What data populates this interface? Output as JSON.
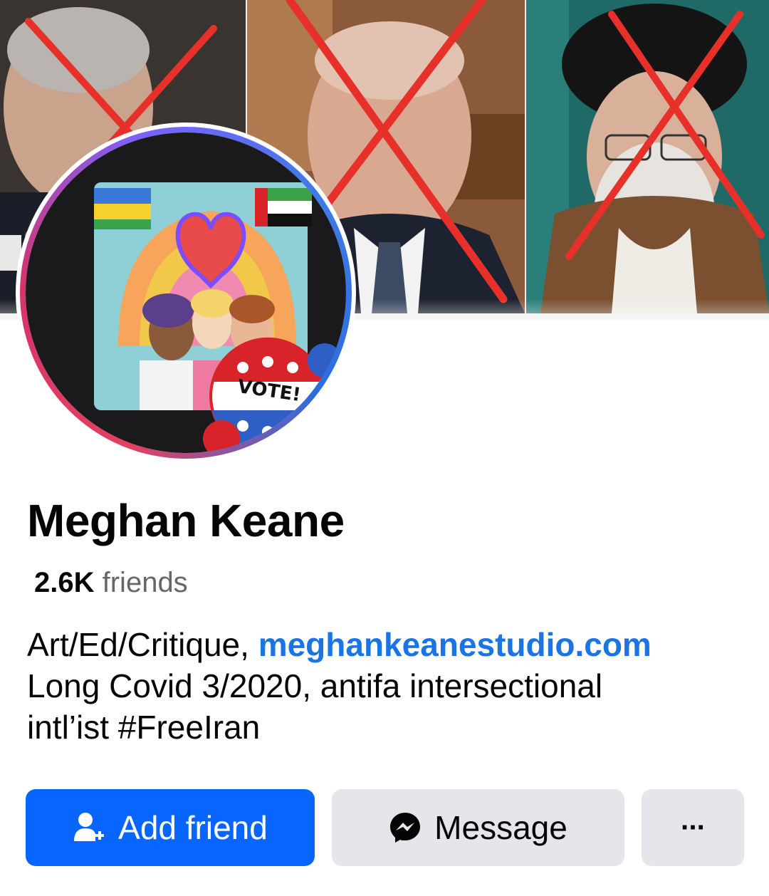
{
  "profile": {
    "name": "Meghan Keane",
    "friends_count": "2.6K",
    "friends_label": "friends",
    "bio_prefix": "Art/Ed/Critique, ",
    "bio_link": "meghankeanestudio.com",
    "bio_line2": "Long Covid 3/2020, antifa intersectional",
    "bio_line3": "intl’ist #FreeIran"
  },
  "avatar": {
    "badge_text": "VOTE!"
  },
  "actions": {
    "add_friend_label": "Add friend",
    "add_friend_icon": "add-person-icon",
    "message_label": "Message",
    "message_icon": "messenger-icon",
    "more_label": "···"
  },
  "colors": {
    "primary": "#0866ff",
    "link": "#1b74e4",
    "secondary_button": "#e4e6eb",
    "cross_red": "#e8302a"
  }
}
